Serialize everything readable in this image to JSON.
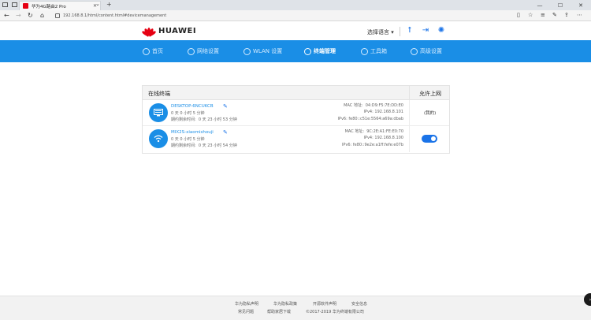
{
  "browser": {
    "tab_title": "华为4G路由2 Pro",
    "url": "192.168.8.1/html/content.html#devicemanagement"
  },
  "header": {
    "brand": "HUAWEI",
    "language": "选择语言"
  },
  "nav": {
    "items": [
      {
        "label": "首页",
        "icon": "home-icon"
      },
      {
        "label": "网络设置",
        "icon": "globe-icon"
      },
      {
        "label": "WLAN 设置",
        "icon": "wifi-icon"
      },
      {
        "label": "终端管理",
        "icon": "devices-icon",
        "active": true
      },
      {
        "label": "工具箱",
        "icon": "toolbox-icon"
      },
      {
        "label": "高级设置",
        "icon": "gear-icon"
      }
    ]
  },
  "card": {
    "title": "在线终端",
    "allow_header": "允许上网",
    "devices": [
      {
        "name": "DESKTOP-6NCUKCB",
        "online_time": "0 天 0 小时 5 分钟",
        "remaining_label": "期约剩余时间:",
        "remaining": "0 天 23 小时 53 分钟",
        "mac_label": "MAC 地址:",
        "mac": "04:D9:F5:7E:DD:E0",
        "ipv4_label": "IPv4:",
        "ipv4": "192.168.8.101",
        "ipv6_label": "IPv6:",
        "ipv6": "fe80::c51e:5564:a69a:dbab",
        "allow": "(我的)",
        "icon": "desktop-icon"
      },
      {
        "name": "MIX2S-xiaomishouji",
        "online_time": "0 天 0 小时 5 分钟",
        "remaining_label": "期约剩余时间:",
        "remaining": "0 天 23 小时 54 分钟",
        "mac_label": "MAC 地址:",
        "mac": "9C:2E:A1:FE:E0:70",
        "ipv4_label": "IPv4:",
        "ipv4": "192.168.8.100",
        "ipv6_label": "IPv6:",
        "ipv6": "fe80::9e2e:a1ff:fefe:e07b",
        "allow_on": true,
        "icon": "wifi-icon"
      }
    ]
  },
  "footer": {
    "links_row1": [
      "华为隐私声明",
      "华为隐私政策",
      "开源软件声明",
      "安全信息"
    ],
    "links_row2": [
      "常见问题",
      "帮助家居下载",
      "©2017-2019 华为终端有限公司"
    ]
  },
  "colors": {
    "accent": "#1a8ee6",
    "brand_red": "#e60012"
  }
}
